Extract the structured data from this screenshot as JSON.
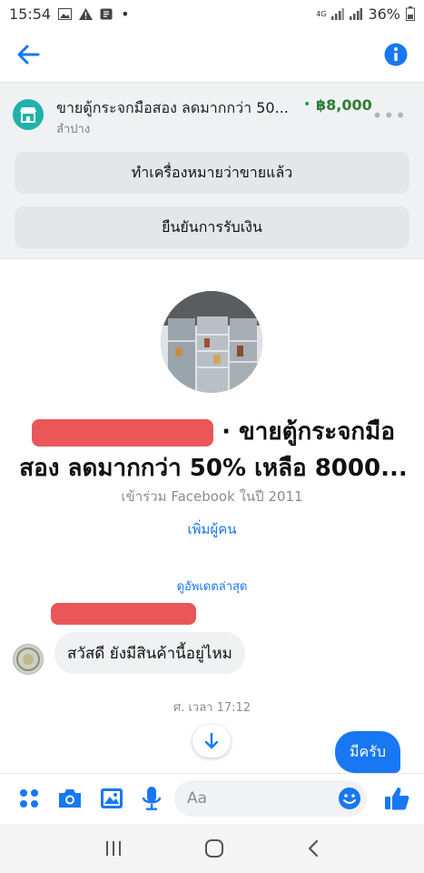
{
  "status": {
    "time": "15:54",
    "dot": "•",
    "battery": "36%",
    "network": "4G"
  },
  "listing": {
    "title": "ขายตู้กระจกมือสอง ลดมากกว่า 50...",
    "separator": "•",
    "price": "฿8,000",
    "location": "ลำปาง",
    "more": "•••",
    "mark_sold_label": "ทำเครื่องหมายว่าขายแล้ว",
    "confirm_payment_label": "ยืนยันการรับเงิน"
  },
  "profile": {
    "title_suffix": "· ขายตู้กระจกมือ",
    "title_line2": "สอง ลดมากกว่า 50% เหลือ 8000...",
    "joined": "เข้าร่วม Facebook ในปี 2011",
    "add_people": "เพิ่มผู้คน"
  },
  "conversation": {
    "updates_label": "ดูอัพเดตล่าสุด",
    "incoming_message": "สวัสดี ยังมีสินค้านี้อยู่ไหม",
    "timestamp": "ศ. เวลา 17:12",
    "outgoing_message": "มีครับ"
  },
  "composer": {
    "placeholder": "Aa"
  },
  "colors": {
    "accent": "#1877f2",
    "price": "#2e7d32",
    "store_icon": "#20b2aa",
    "redaction": "#e8383c"
  }
}
